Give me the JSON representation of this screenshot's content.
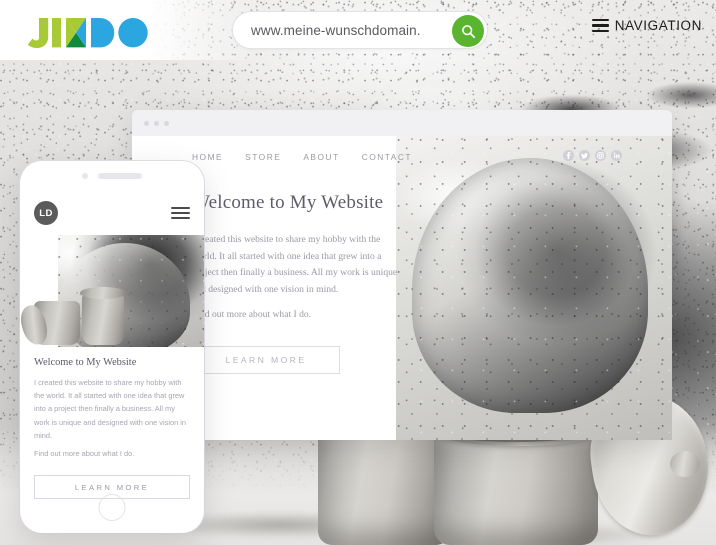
{
  "header": {
    "logo": {
      "name": "jimdo-logo",
      "text": "JIMDO",
      "colors": {
        "green": "#a8ca37",
        "dark_green": "#0e8a3e",
        "blue": "#2ba6e0"
      }
    },
    "search": {
      "value": "www.meine-wunschdomain.",
      "placeholder": "www.meine-wunschdomain.de",
      "button_icon": "search-icon",
      "button_color": "#5bb430"
    },
    "nav": {
      "icon": "hamburger-menu-icon",
      "label": "NAVIGATION"
    }
  },
  "desktop_preview": {
    "window_dots": 3,
    "nav_items": [
      {
        "label": "HOME"
      },
      {
        "label": "STORE"
      },
      {
        "label": "ABOUT"
      },
      {
        "label": "CONTACT"
      }
    ],
    "social": [
      {
        "name": "facebook-icon",
        "glyph": "f"
      },
      {
        "name": "twitter-icon",
        "glyph": "t"
      },
      {
        "name": "instagram-icon",
        "glyph": "o"
      },
      {
        "name": "linkedin-icon",
        "glyph": "in"
      }
    ],
    "heading": "Welcome to My Website",
    "paragraph": "I created this website to share my hobby with the world. It all started with one idea that grew into a project then finally a business. All my work is unique and designed with one vision in mind.",
    "paragraph_last": "Find out more about what I do.",
    "button_label": "LEARN MORE"
  },
  "phone_preview": {
    "logo_initials": "LD",
    "menu_icon": "hamburger-menu-icon",
    "heading": "Welcome to My Website",
    "paragraph": "I created this website to share my hobby with the world. It all started with one idea that grew into a project then finally a business. All my work is unique and designed with one vision in mind.",
    "paragraph_last": "Find out more about what I do.",
    "button_label": "LEARN MORE",
    "home_button": "home-button"
  }
}
